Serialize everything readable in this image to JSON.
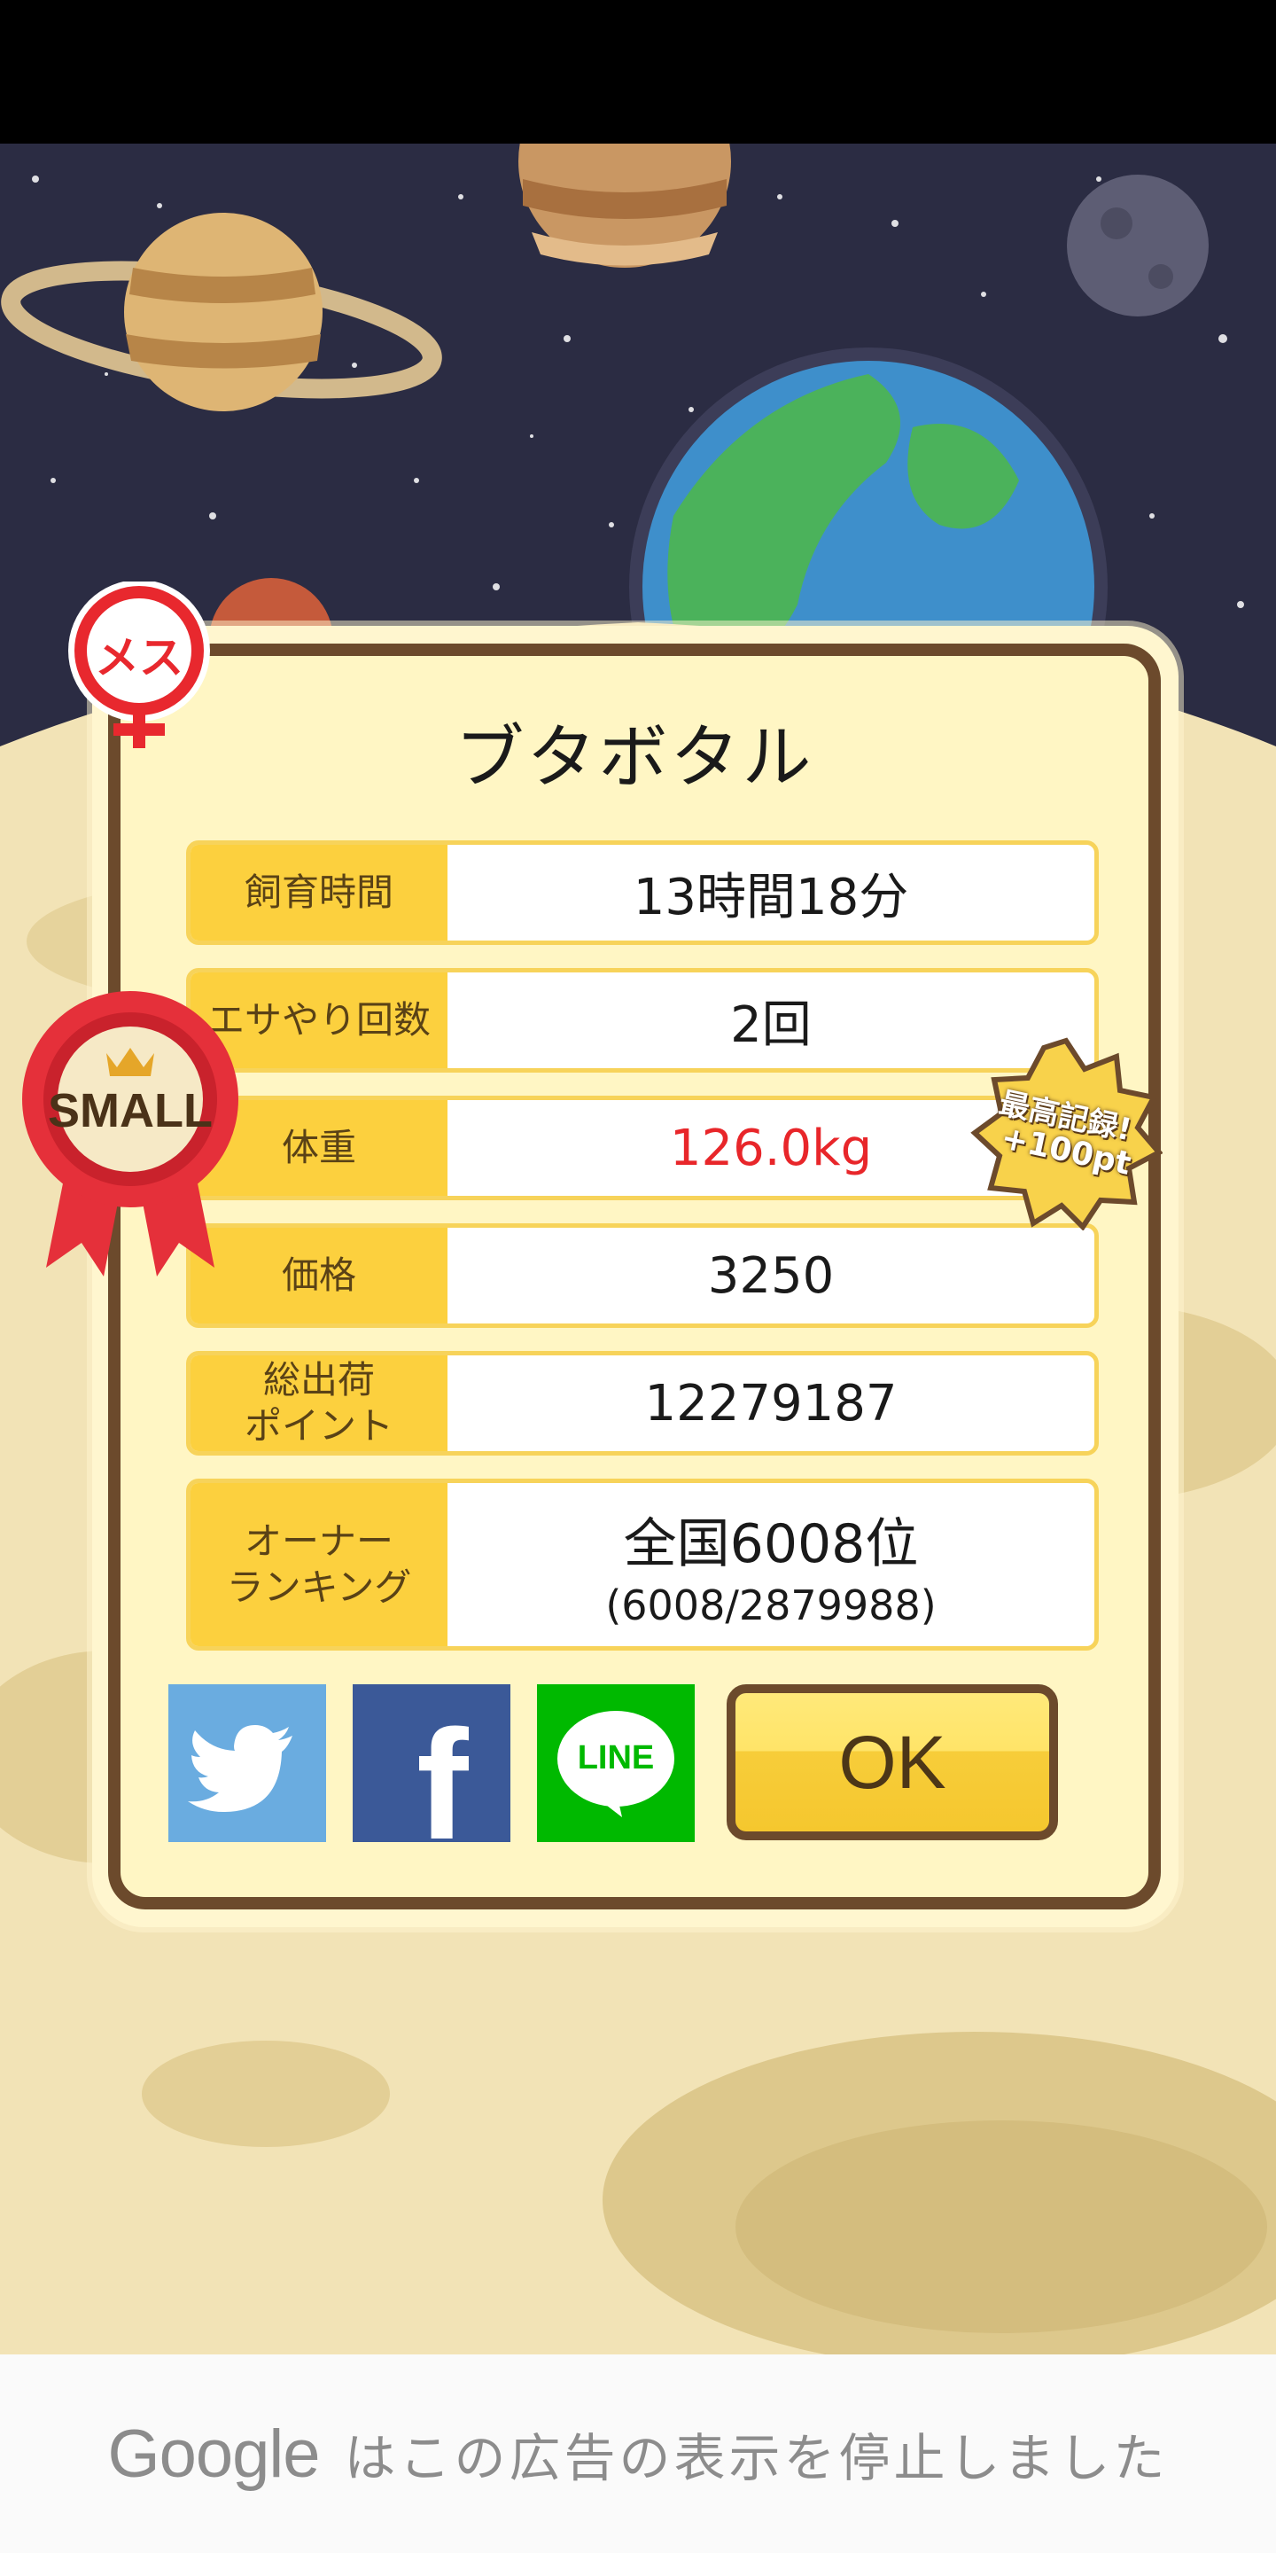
{
  "dialog": {
    "title": "ブタボタル",
    "rows": [
      {
        "label": "飼育時間",
        "value": "13時間18分"
      },
      {
        "label": "エサやり回数",
        "value": "2回"
      },
      {
        "label": "体重",
        "value": "126.0kg"
      },
      {
        "label": "価格",
        "value": "3250"
      },
      {
        "label": "総出荷\nポイント",
        "value": "12279187"
      },
      {
        "label": "オーナー\nランキング",
        "value": "全国6008位",
        "sub": "(6008/2879988)"
      }
    ],
    "ok_label": "OK"
  },
  "badges": {
    "gender": "メス",
    "size": "SMALL",
    "record_line1": "最高記録!",
    "record_line2": "+100pt"
  },
  "social": {
    "twitter": "twitter-icon",
    "facebook": "f",
    "line": "LINE"
  },
  "ad": {
    "brand": "Google",
    "message": "はこの広告の表示を停止しました"
  },
  "colors": {
    "label_bg": "#fcd03e",
    "weight_text": "#e8262a",
    "frame": "#6c4a2c",
    "twitter": "#6aace0",
    "facebook": "#3b5998",
    "line": "#00b900"
  }
}
